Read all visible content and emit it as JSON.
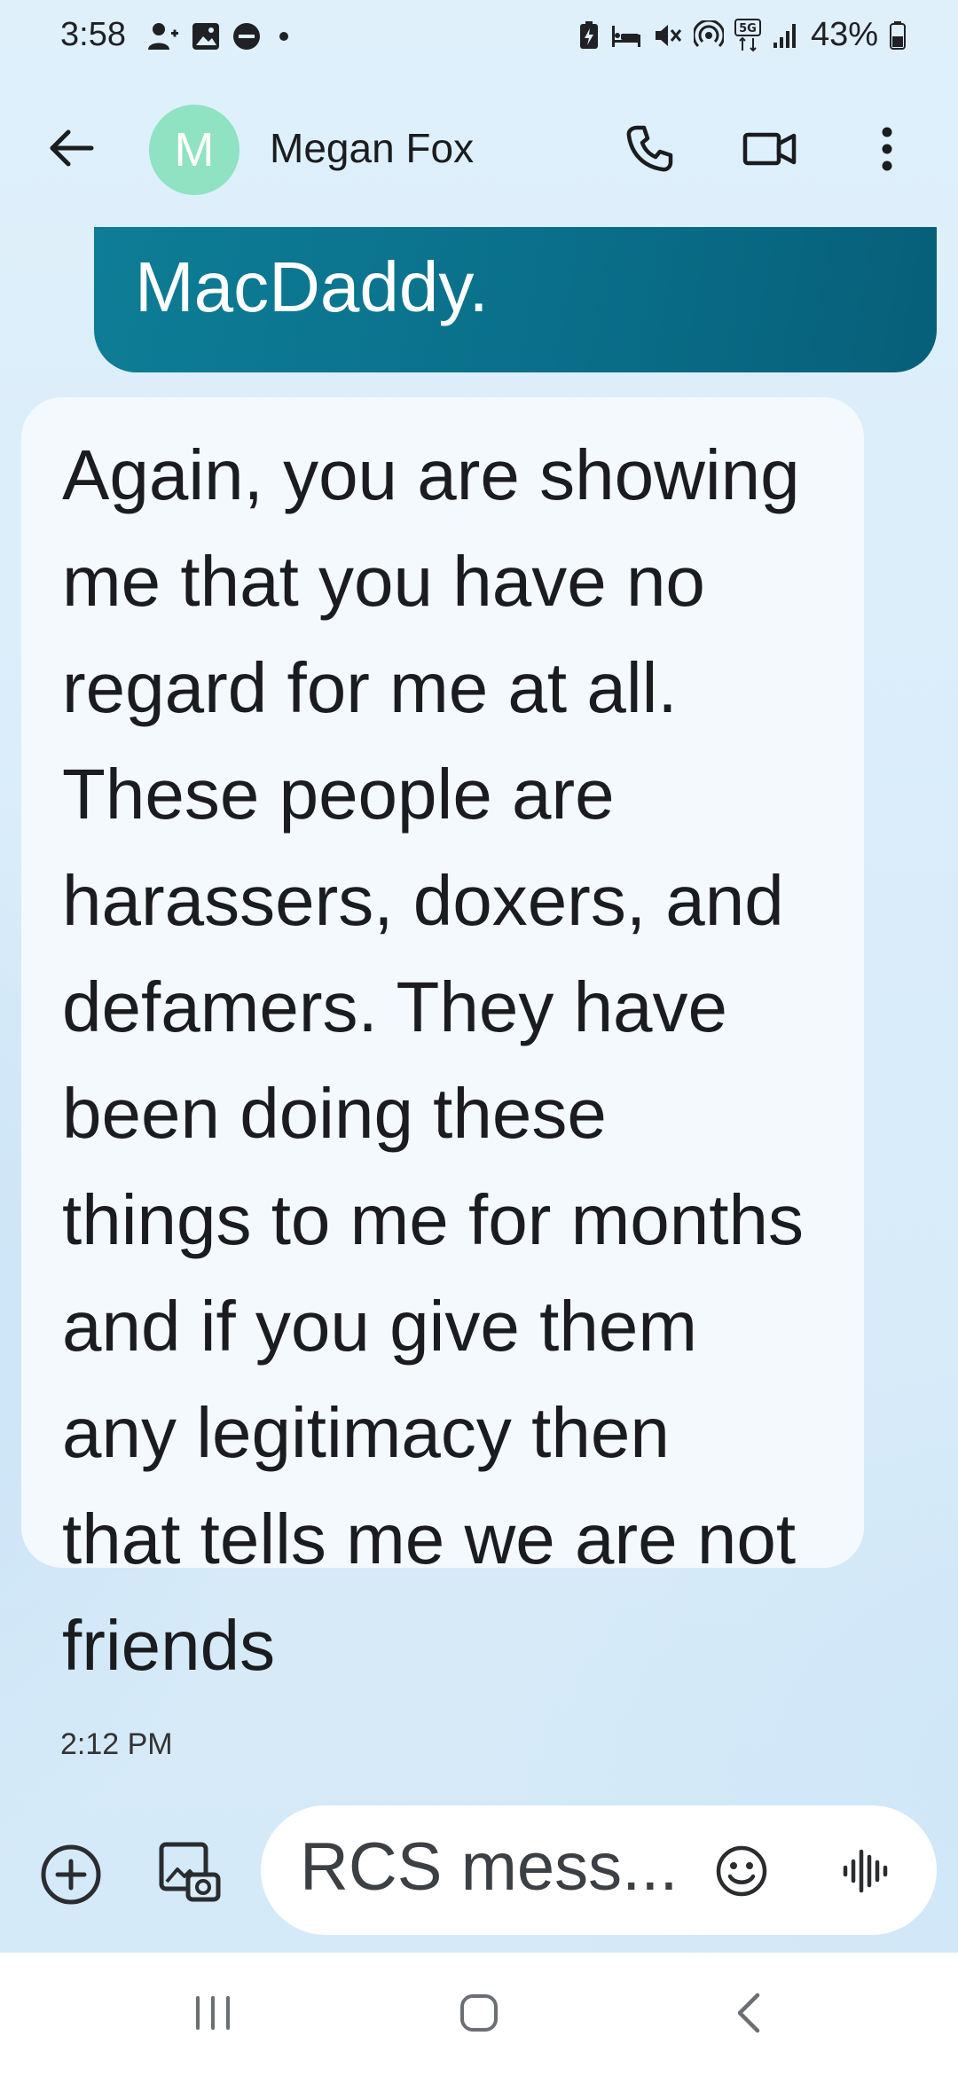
{
  "status_bar": {
    "time": "3:58",
    "battery": "43%",
    "network": "5G",
    "left_icons": [
      "person-add-icon",
      "image-icon",
      "do-not-disturb-icon",
      "dot-icon"
    ],
    "right_icons": [
      "battery-saver-icon",
      "sleep-icon",
      "mute-icon",
      "hotspot-icon",
      "5g-icon",
      "signal-icon",
      "battery-icon"
    ]
  },
  "header": {
    "avatar_letter": "M",
    "avatar_color": "#8fe3c2",
    "contact_name": "Megan Fox",
    "icons": [
      "back-arrow-icon",
      "phone-icon",
      "video-camera-icon",
      "more-vert-icon"
    ]
  },
  "messages": [
    {
      "direction": "outgoing",
      "text": "MacDaddy.",
      "color": "#0a6f8a"
    },
    {
      "direction": "incoming",
      "lines": [
        "Again, you are showing",
        "me that you have no",
        "regard for me at all.",
        "These people are",
        "harassers, doxers, and",
        "defamers. They have",
        "been doing these",
        "things to me for months",
        "and if you give them",
        "any legitimacy then",
        "that tells me we are not",
        "friends"
      ],
      "timestamp": "2:12 PM"
    }
  ],
  "compose": {
    "placeholder": "RCS mess...",
    "icons": [
      "add-circle-icon",
      "gallery-icon",
      "emoji-icon",
      "voice-waveform-icon"
    ]
  },
  "nav_bar": {
    "icons": [
      "recents-icon",
      "home-icon",
      "back-chevron-icon"
    ]
  }
}
